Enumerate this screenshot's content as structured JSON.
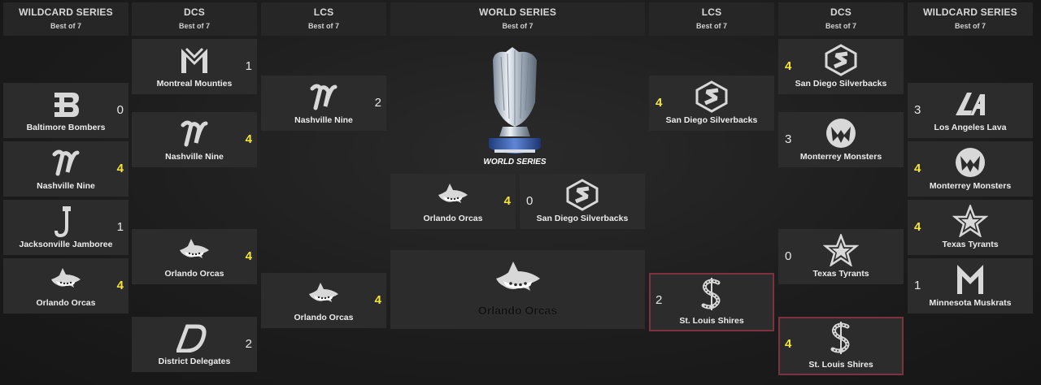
{
  "headers": [
    {
      "title": "WILDCARD SERIES",
      "sub": "Best of 7"
    },
    {
      "title": "DCS",
      "sub": "Best of 7"
    },
    {
      "title": "LCS",
      "sub": "Best of 7"
    },
    {
      "title": "WORLD SERIES",
      "sub": "Best of 7"
    },
    {
      "title": "LCS",
      "sub": "Best of 7"
    },
    {
      "title": "DCS",
      "sub": "Best of 7"
    },
    {
      "title": "WILDCARD SERIES",
      "sub": "Best of 7"
    }
  ],
  "trophy": {
    "caption": "WORLD SERIES",
    "icon": "trophy-icon"
  },
  "champion": {
    "name": "Orlando Orcas",
    "icon": "orca-icon"
  },
  "colors": {
    "winner_score": "#f5e63c",
    "highlight_border": "#7a3440"
  },
  "matchups": {
    "wc_left": [
      {
        "team": "Baltimore Bombers",
        "score": "0",
        "icon": "bombers-icon"
      },
      {
        "team": "Nashville Nine",
        "score": "4",
        "icon": "nine-icon"
      },
      {
        "team": "Jacksonville Jamboree",
        "score": "1",
        "icon": "jamboree-icon"
      },
      {
        "team": "Orlando Orcas",
        "score": "4",
        "icon": "orca-icon"
      }
    ],
    "dcs_left": [
      {
        "team": "Montreal Mounties",
        "score": "1",
        "icon": "mounties-icon"
      },
      {
        "team": "Nashville Nine",
        "score": "4",
        "icon": "nine-icon"
      },
      {
        "team": "Orlando Orcas",
        "score": "4",
        "icon": "orca-icon"
      },
      {
        "team": "District Delegates",
        "score": "2",
        "icon": "delegates-icon"
      }
    ],
    "lcs_left": [
      {
        "team": "Nashville Nine",
        "score": "2",
        "icon": "nine-icon"
      },
      {
        "team": "Orlando Orcas",
        "score": "4",
        "icon": "orca-icon"
      }
    ],
    "world_series": [
      {
        "team": "Orlando Orcas",
        "score": "4",
        "icon": "orca-icon"
      },
      {
        "team": "San Diego Silverbacks",
        "score": "0",
        "icon": "silverbacks-icon"
      }
    ],
    "lcs_right": [
      {
        "team": "San Diego Silverbacks",
        "score": "4",
        "icon": "silverbacks-icon"
      },
      {
        "team": "St. Louis Shires",
        "score": "2",
        "icon": "shires-icon"
      }
    ],
    "dcs_right": [
      {
        "team": "San Diego Silverbacks",
        "score": "4",
        "icon": "silverbacks-icon"
      },
      {
        "team": "Monterrey Monsters",
        "score": "3",
        "icon": "monsters-icon"
      },
      {
        "team": "Texas Tyrants",
        "score": "0",
        "icon": "tyrants-icon"
      },
      {
        "team": "St. Louis Shires",
        "score": "4",
        "icon": "shires-icon"
      }
    ],
    "wc_right": [
      {
        "team": "Los Angeles Lava",
        "score": "3",
        "icon": "lava-icon"
      },
      {
        "team": "Monterrey Monsters",
        "score": "4",
        "icon": "monsters-icon"
      },
      {
        "team": "Texas Tyrants",
        "score": "4",
        "icon": "tyrants-icon"
      },
      {
        "team": "Minnesota Muskrats",
        "score": "1",
        "icon": "muskrats-icon"
      }
    ]
  }
}
